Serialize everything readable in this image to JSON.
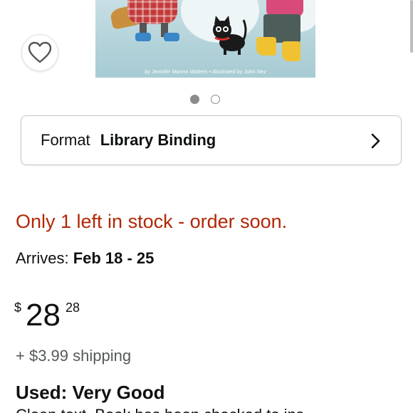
{
  "product_image": {
    "credit": "by Jennifer Marino Walters • illustrated by John Nez"
  },
  "wishlist": {
    "icon": "heart-icon"
  },
  "carousel": {
    "total": 2,
    "active_index": 0
  },
  "format": {
    "label": "Format",
    "value": "Library Binding",
    "icon": "chevron-right-icon"
  },
  "stock": {
    "message": "Only 1 left in stock - order soon."
  },
  "delivery": {
    "label": "Arrives:",
    "dates": "Feb 18 - 25"
  },
  "price": {
    "currency": "$",
    "whole": "28",
    "fraction": "28"
  },
  "shipping": {
    "text": "+ $3.99 shipping"
  },
  "condition": {
    "title": "Used: Very Good"
  },
  "description": {
    "text": "Clean text. Book has been checked to ins..."
  },
  "colors": {
    "stock_red": "#B12704",
    "text": "#0F1111",
    "muted": "#565959"
  }
}
